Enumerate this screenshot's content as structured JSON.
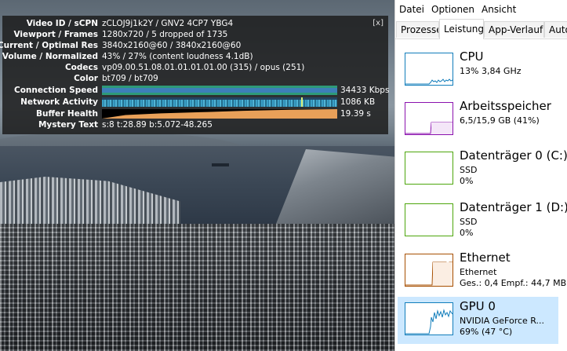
{
  "stats": {
    "close_label": "[x]",
    "rows": [
      {
        "label": "Video ID / sCPN",
        "value": "zCLOJ9j1k2Y / GNV2 4CP7 YBG4"
      },
      {
        "label": "Viewport / Frames",
        "value": "1280x720 / 5 dropped of 1735"
      },
      {
        "label": "Current / Optimal Res",
        "value": "3840x2160@60 / 3840x2160@60"
      },
      {
        "label": "Volume / Normalized",
        "value": "43% / 27% (content loudness 4.1dB)"
      },
      {
        "label": "Codecs",
        "value": "vp09.00.51.08.01.01.01.01.00 (315) / opus (251)"
      },
      {
        "label": "Color",
        "value": "bt709 / bt709"
      }
    ],
    "connection_speed": {
      "label": "Connection Speed",
      "value": "34433 Kbps"
    },
    "network_activity": {
      "label": "Network Activity",
      "value": "1086 KB"
    },
    "buffer_health": {
      "label": "Buffer Health",
      "value": "19.39 s"
    },
    "mystery_text": {
      "label": "Mystery Text",
      "value": "s:8 t:28.89 b:5.072-48.265"
    }
  },
  "taskmanager": {
    "menu": [
      "Datei",
      "Optionen",
      "Ansicht"
    ],
    "tabs": [
      "Prozesse",
      "Leistung",
      "App-Verlauf",
      "Auto"
    ],
    "active_tab": "Leistung",
    "resources": [
      {
        "name": "CPU",
        "line1": "13%  3,84 GHz",
        "color": "#117dbb"
      },
      {
        "name": "Arbeitsspeicher",
        "line1": "6,5/15,9 GB (41%)",
        "color": "#8b12ae"
      },
      {
        "name": "Datenträger 0 (C:)",
        "line1": "SSD",
        "line2": "0%",
        "color": "#4da60c"
      },
      {
        "name": "Datenträger 1 (D:)",
        "line1": "SSD",
        "line2": "0%",
        "color": "#4da60c"
      },
      {
        "name": "Ethernet",
        "line1": "Ethernet",
        "line2": "Ges.: 0,4  Empf.: 44,7 MBit",
        "color": "#a74f01"
      },
      {
        "name": "GPU 0",
        "line1": "NVIDIA GeForce R...",
        "line2": "69%  (47 °C)",
        "color": "#117dbb"
      }
    ]
  }
}
